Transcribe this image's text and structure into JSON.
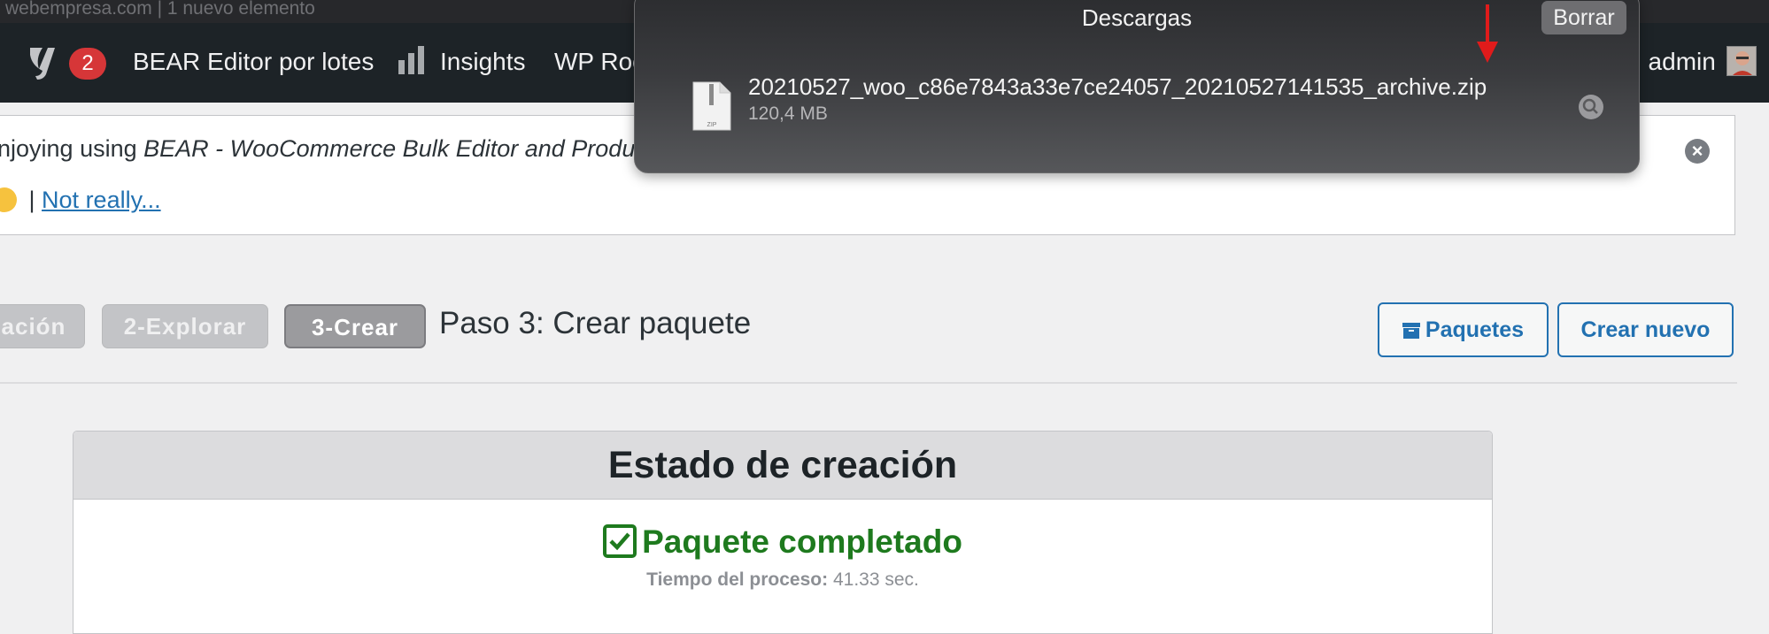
{
  "browser": {
    "tab_text": "webempresa.com | 1 nuevo elemento"
  },
  "admin_bar": {
    "yoast_count": "2",
    "bear_label": "BEAR Editor por lotes",
    "insights_label": "Insights",
    "wp_rocket_label": "WP Roc",
    "admin_label": ", admin"
  },
  "notice": {
    "text_prefix": "njoying using ",
    "text_italic": "BEAR - WooCommerce Bulk Editor and Produ",
    "separator": "|",
    "not_really": "Not really..."
  },
  "steps": {
    "step1": "ación",
    "step2": "2-Explorar",
    "step3": "3-Crear",
    "title": "Paso 3: Crear paquete"
  },
  "toolbar": {
    "paquetes_label": "Paquetes",
    "crear_nuevo_label": "Crear nuevo"
  },
  "panel": {
    "header": "Estado de creación",
    "status": "Paquete completado",
    "time_label": "Tiempo del proceso:",
    "time_value": "41.33 sec."
  },
  "downloads": {
    "title": "Descargas",
    "clear_label": "Borrar",
    "file_name": "20210527_woo_c86e7843a33e7ce24057_20210527141535_archive.zip",
    "file_size": "120,4 MB",
    "icon_text": "ZIP"
  },
  "colors": {
    "admin_bar": "#1d2327",
    "badge": "#d63638",
    "link": "#2271b1",
    "success": "#1e7a1e",
    "annotation_arrow": "#e01b1b"
  }
}
